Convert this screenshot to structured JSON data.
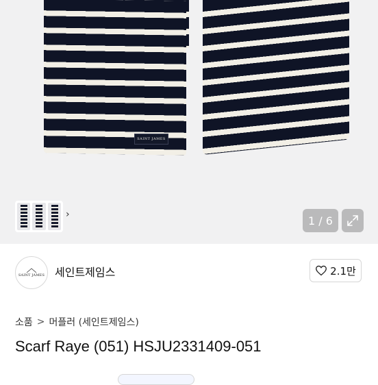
{
  "hero": {
    "product_label": "SAINT JAMES",
    "counter": "1 / 6"
  },
  "seller": {
    "logo_text": "SAINT JAMES",
    "name": "세인트제임스",
    "like_count": "2.1만"
  },
  "breadcrumb": {
    "root": "소품",
    "separator": ">",
    "category": "머플러 (세인트제임스)"
  },
  "product": {
    "title": "Scarf Raye (051) HSJU2331409-051"
  },
  "colors": {
    "stripe_navy": "#0f1426",
    "stripe_cream": "#f2efe6",
    "hero_bg": "#f1f1f2"
  }
}
